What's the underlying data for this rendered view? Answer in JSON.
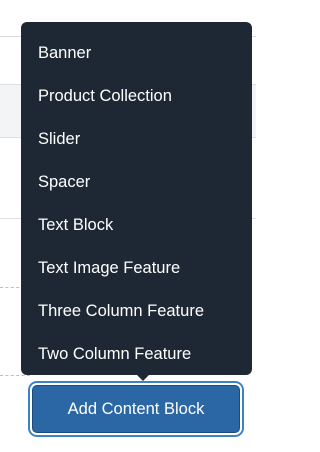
{
  "menu": {
    "items": [
      {
        "label": "Banner"
      },
      {
        "label": "Product Collection"
      },
      {
        "label": "Slider"
      },
      {
        "label": "Spacer"
      },
      {
        "label": "Text Block"
      },
      {
        "label": "Text Image Feature"
      },
      {
        "label": "Three Column Feature"
      },
      {
        "label": "Two Column Feature"
      }
    ]
  },
  "actions": {
    "add_content_block_label": "Add Content Block"
  },
  "colors": {
    "menu_background": "#1e2834",
    "button_background": "#2b67a4",
    "button_focus_ring": "#3d82c5",
    "menu_text": "#ffffff"
  }
}
